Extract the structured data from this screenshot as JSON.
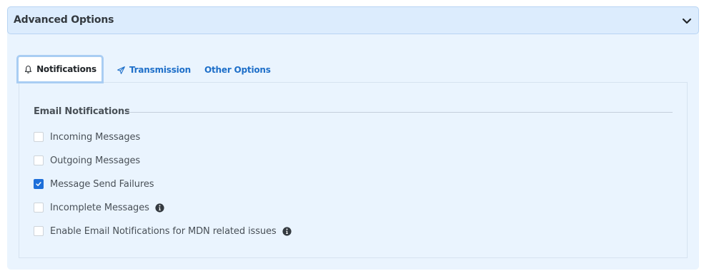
{
  "panel": {
    "title": "Advanced Options",
    "collapse_icon": "chevron-down-icon"
  },
  "tabs": [
    {
      "label": "Notifications",
      "icon": "bell-icon",
      "active": true
    },
    {
      "label": "Transmission",
      "icon": "paper-plane-icon",
      "active": false
    },
    {
      "label": "Other Options",
      "icon": "",
      "active": false
    }
  ],
  "section": {
    "title": "Email Notifications"
  },
  "options": [
    {
      "label": "Incoming Messages",
      "checked": false,
      "info": false
    },
    {
      "label": "Outgoing Messages",
      "checked": false,
      "info": false
    },
    {
      "label": "Message Send Failures",
      "checked": true,
      "info": false
    },
    {
      "label": "Incomplete Messages",
      "checked": false,
      "info": true
    },
    {
      "label": "Enable Email Notifications for MDN related issues",
      "checked": false,
      "info": true
    }
  ],
  "colors": {
    "accent": "#1e6fd9",
    "link": "#1e6fc9",
    "panel_bg": "#eaf4fe",
    "header_bg": "#dcecfd"
  }
}
